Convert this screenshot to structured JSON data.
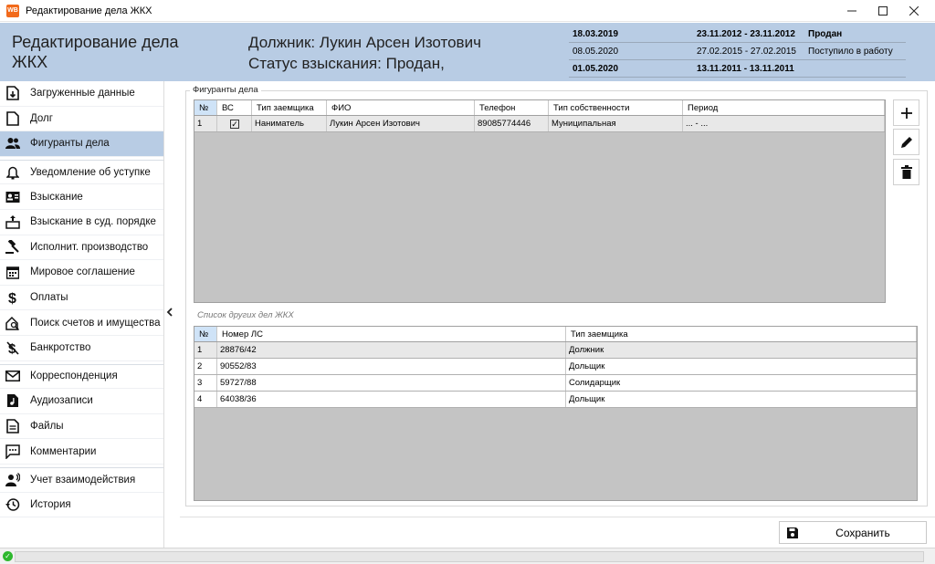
{
  "window": {
    "title": "Редактирование дела ЖКХ",
    "icon_text": "WB"
  },
  "header": {
    "case_title": "Редактирование дела ЖКХ",
    "debtor": "Должник: Лукин Арсен Изотович",
    "status": "Статус взыскания: Продан,",
    "history": [
      {
        "date": "18.03.2019",
        "period": "23.11.2012 - 23.11.2012",
        "status": "Продан",
        "bold": true
      },
      {
        "date": "08.05.2020",
        "period": "27.02.2015 - 27.02.2015",
        "status": "Поступило в работу",
        "bold": false
      },
      {
        "date": "01.05.2020",
        "period": "13.11.2011 - 13.11.2011",
        "status": "",
        "bold": true
      }
    ]
  },
  "sidebar": {
    "items": [
      {
        "label": "Загруженные данные",
        "icon": "download-file-icon"
      },
      {
        "label": "Долг",
        "icon": "document-icon"
      },
      {
        "label": "Фигуранты дела",
        "icon": "people-icon",
        "active": true
      },
      {
        "label": "Уведомление об уступке",
        "icon": "bell-icon"
      },
      {
        "label": "Взыскание",
        "icon": "contact-card-icon"
      },
      {
        "label": "Взыскание в суд. порядке",
        "icon": "court-transfer-icon"
      },
      {
        "label": "Исполнит. производство",
        "icon": "gavel-icon"
      },
      {
        "label": "Мировое соглашение",
        "icon": "calendar-icon"
      },
      {
        "label": "Оплаты",
        "icon": "dollar-icon"
      },
      {
        "label": "Поиск счетов и имущества",
        "icon": "home-search-icon"
      },
      {
        "label": "Банкротство",
        "icon": "money-off-icon"
      },
      {
        "label": "Корреспонденция",
        "icon": "envelope-icon"
      },
      {
        "label": "Аудиозаписи",
        "icon": "audio-file-icon"
      },
      {
        "label": "Файлы",
        "icon": "file-icon"
      },
      {
        "label": "Комментарии",
        "icon": "comment-icon"
      },
      {
        "label": "Учет взаимодействия",
        "icon": "interaction-icon"
      },
      {
        "label": "История",
        "icon": "history-icon"
      }
    ]
  },
  "participants": {
    "group_label": "Фигуранты дела",
    "columns": [
      "№",
      "ВС",
      "Тип заемщика",
      "ФИО",
      "Телефон",
      "Тип собственности",
      "Период"
    ],
    "rows": [
      {
        "num": "1",
        "vs_checked": true,
        "type": "Наниматель",
        "fio": "Лукин Арсен Изотович",
        "phone": "89085774446",
        "ownership": "Муниципальная",
        "period": "... - ..."
      }
    ]
  },
  "other_cases": {
    "label": "Список других дел ЖКХ",
    "columns": [
      "№",
      "Номер ЛС",
      "Тип заемщика"
    ],
    "rows": [
      {
        "num": "1",
        "account": "28876/42",
        "type": "Должник"
      },
      {
        "num": "2",
        "account": "90552/83",
        "type": "Дольщик"
      },
      {
        "num": "3",
        "account": "59727/88",
        "type": "Солидарщик"
      },
      {
        "num": "4",
        "account": "64038/36",
        "type": "Дольщик"
      }
    ]
  },
  "actions": {
    "add_icon": "plus-icon",
    "edit_icon": "pencil-icon",
    "delete_icon": "trash-icon",
    "collapse_icon": "chevron-left-icon"
  },
  "footer": {
    "save_label": "Сохранить",
    "save_icon": "floppy-disk-icon"
  },
  "colors": {
    "header_bg": "#b8cce4",
    "active_item_bg": "#b8cce4",
    "grid_bg": "#c4c4c4",
    "status_ok": "#2eb82e"
  }
}
